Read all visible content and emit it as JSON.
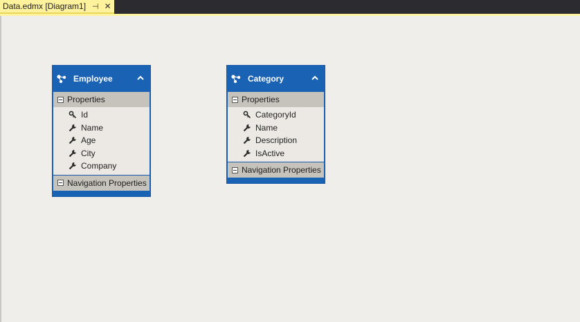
{
  "tab": {
    "title": "Data.edmx [Diagram1]",
    "pin_glyph": "⊣",
    "close_glyph": "✕"
  },
  "colors": {
    "entity_blue": "#1a62b3",
    "section_gray": "#c6c2bc",
    "tab_yellow": "#fff29d",
    "canvas_bg": "#f0eeeb"
  },
  "entities": [
    {
      "name": "Employee",
      "properties_label": "Properties",
      "navigation_label": "Navigation Properties",
      "properties": [
        {
          "name": "Id",
          "icon": "key-icon"
        },
        {
          "name": "Name",
          "icon": "wrench-icon"
        },
        {
          "name": "Age",
          "icon": "wrench-icon"
        },
        {
          "name": "City",
          "icon": "wrench-icon"
        },
        {
          "name": "Company",
          "icon": "wrench-icon"
        }
      ]
    },
    {
      "name": "Category",
      "properties_label": "Properties",
      "navigation_label": "Navigation Properties",
      "properties": [
        {
          "name": "CategoryId",
          "icon": "key-icon"
        },
        {
          "name": "Name",
          "icon": "wrench-icon"
        },
        {
          "name": "Description",
          "icon": "wrench-icon"
        },
        {
          "name": "IsActive",
          "icon": "wrench-icon"
        }
      ]
    }
  ]
}
